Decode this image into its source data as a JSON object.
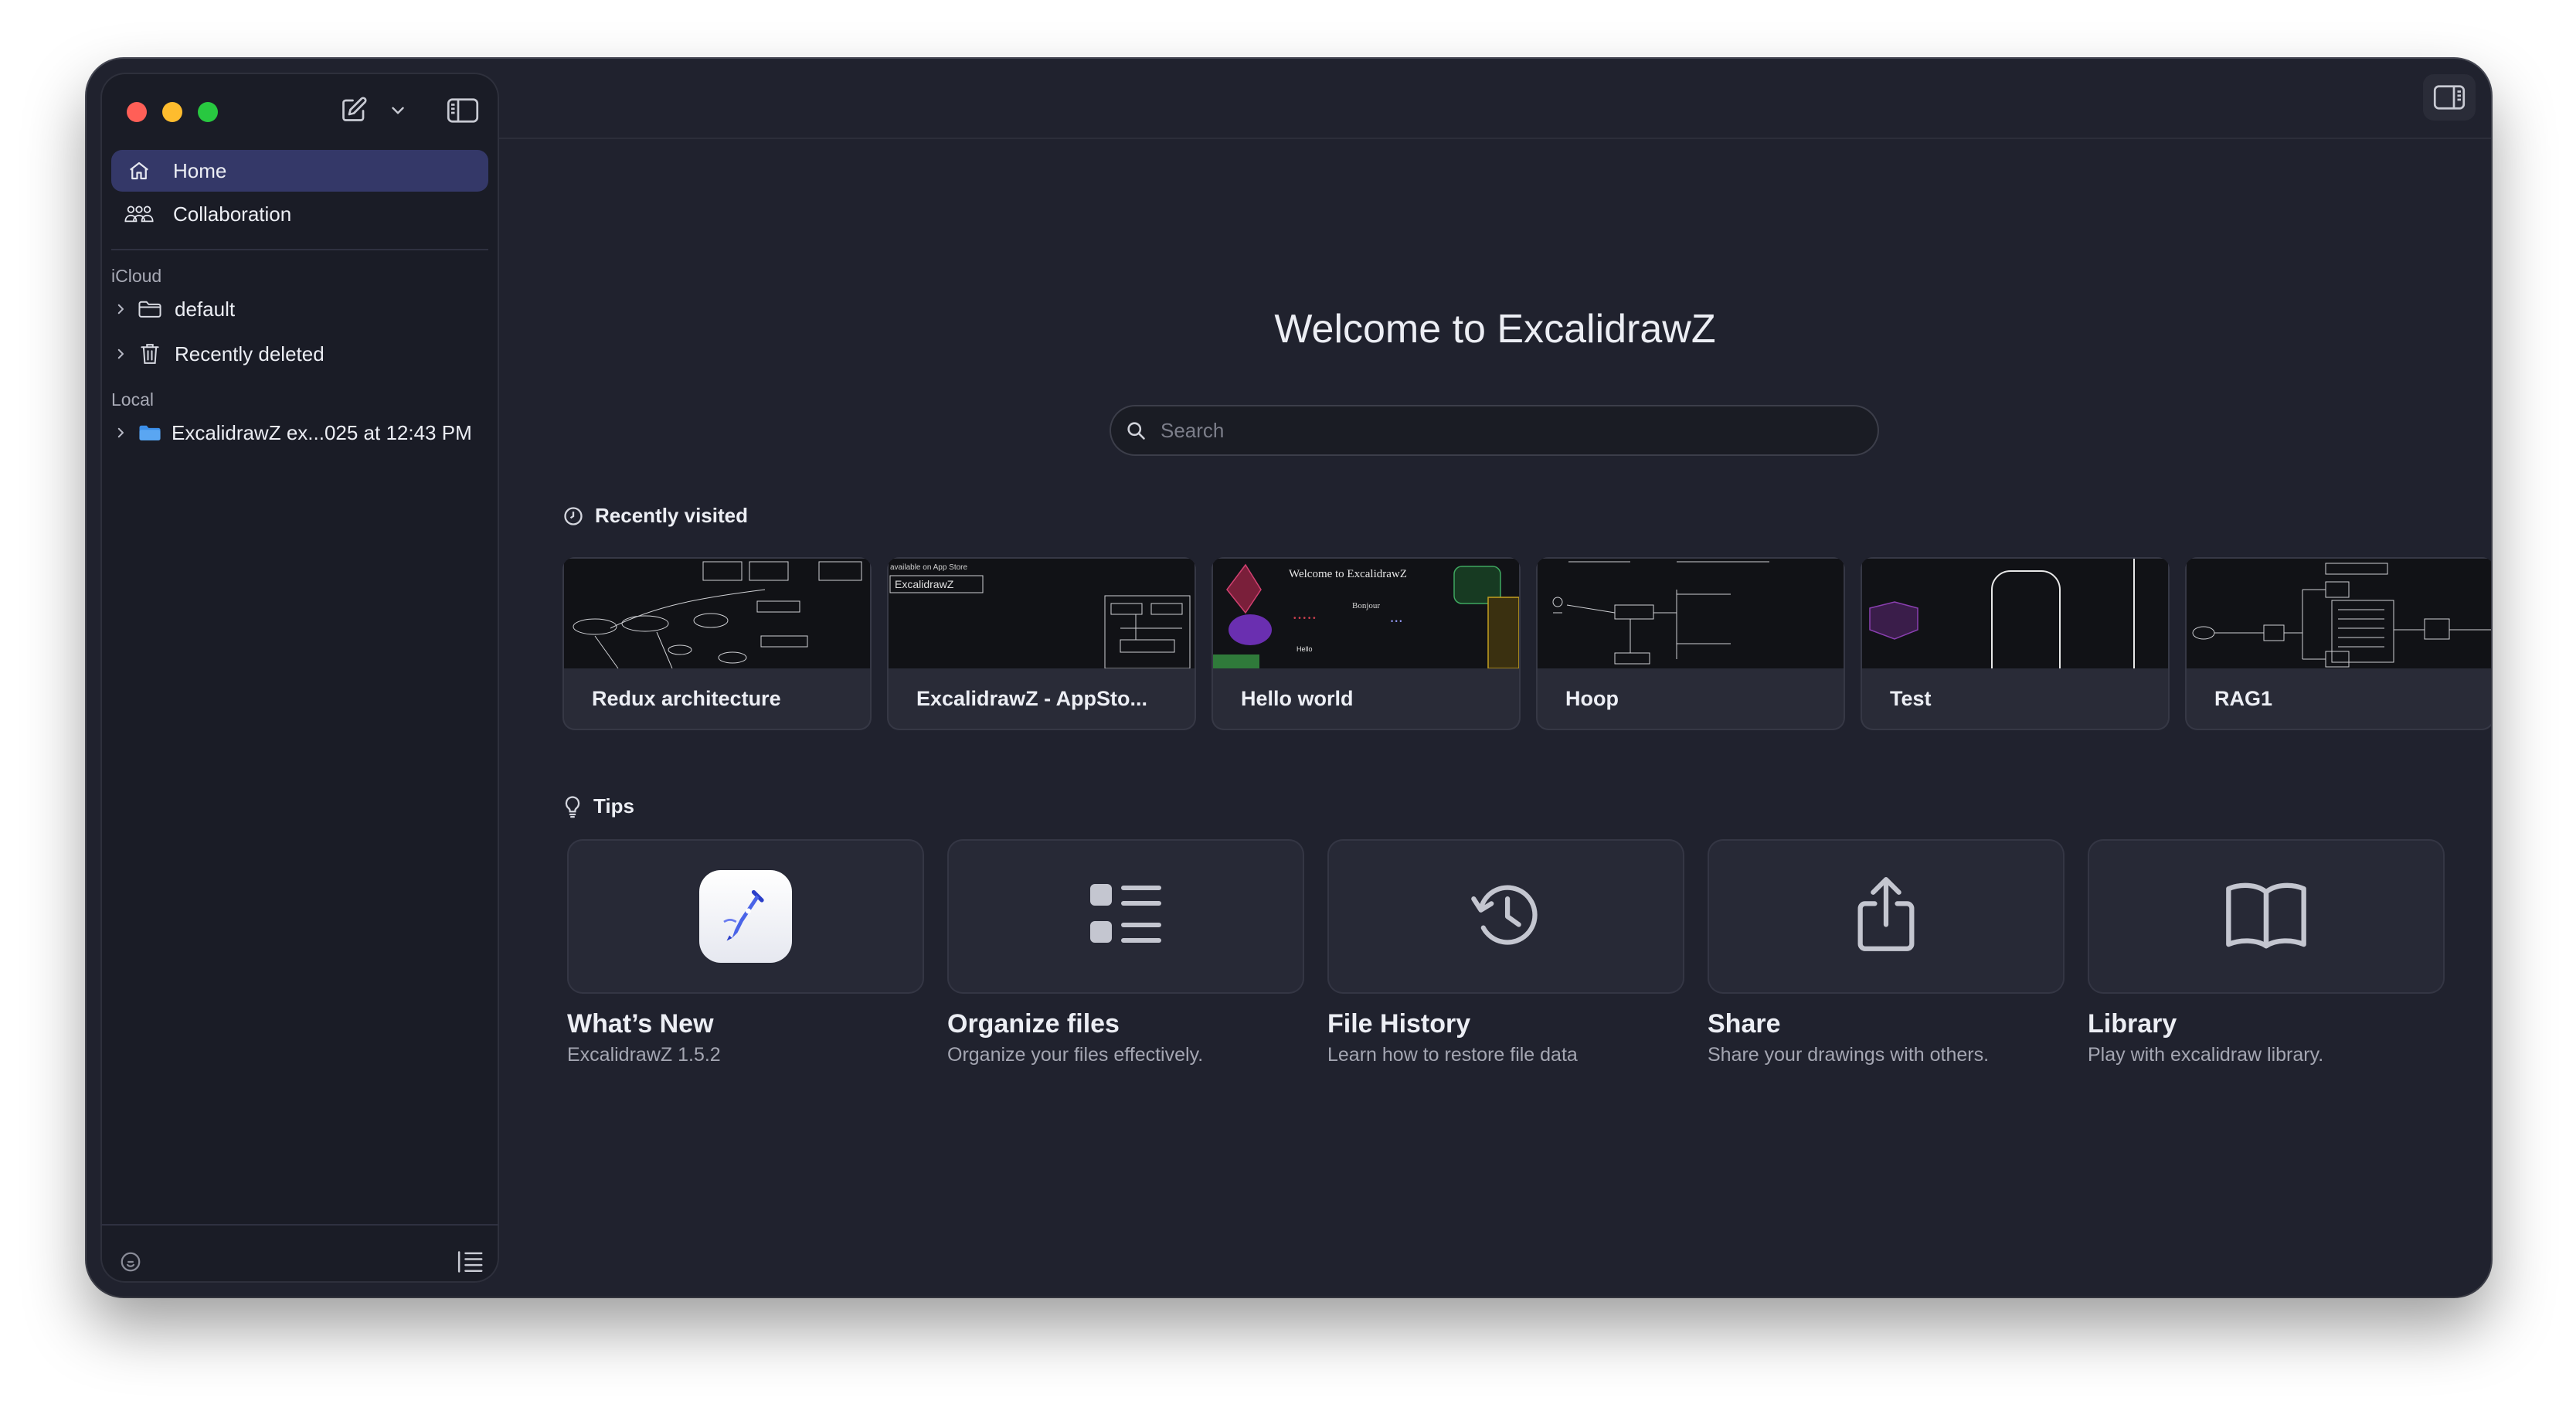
{
  "sidebar": {
    "nav": [
      {
        "label": "Home",
        "icon": "home-icon"
      },
      {
        "label": "Collaboration",
        "icon": "people-icon"
      }
    ],
    "icloud_label": "iCloud",
    "icloud_items": [
      {
        "label": "default",
        "icon": "folder-icon"
      },
      {
        "label": "Recently deleted",
        "icon": "trash-icon"
      }
    ],
    "local_label": "Local",
    "local_items": [
      {
        "label": "ExcalidrawZ ex...025 at 12:43 PM",
        "icon": "folder-filled-icon"
      }
    ]
  },
  "main": {
    "title": "Welcome to ExcalidrawZ",
    "search_placeholder": "Search",
    "recent_heading": "Recently visited",
    "recent": [
      {
        "title": "Redux architecture"
      },
      {
        "title": "ExcalidrawZ - AppSto..."
      },
      {
        "title": "Hello world"
      },
      {
        "title": "Hoop"
      },
      {
        "title": "Test"
      },
      {
        "title": "RAG1"
      }
    ],
    "thumb_text": {
      "appstore_line1": "available on App Store",
      "appstore_line2": "ExcalidrawZ",
      "hello_heading": "Welcome to ExcalidrawZ",
      "hello_bonjour": "Bonjour",
      "hello_hello": "Hello"
    },
    "tips_heading": "Tips",
    "tips": [
      {
        "title": "What’s New",
        "subtitle": "ExcalidrawZ 1.5.2"
      },
      {
        "title": "Organize files",
        "subtitle": "Organize your files effectively."
      },
      {
        "title": "File History",
        "subtitle": "Learn how to restore file data"
      },
      {
        "title": "Share",
        "subtitle": "Share your drawings with others."
      },
      {
        "title": "Library",
        "subtitle": "Play with excalidraw library."
      }
    ]
  },
  "colors": {
    "window_bg": "#20222e",
    "sidebar_bg": "#1a1c26",
    "accent_active": "#343868",
    "folder_blue": "#3b8ee8"
  }
}
